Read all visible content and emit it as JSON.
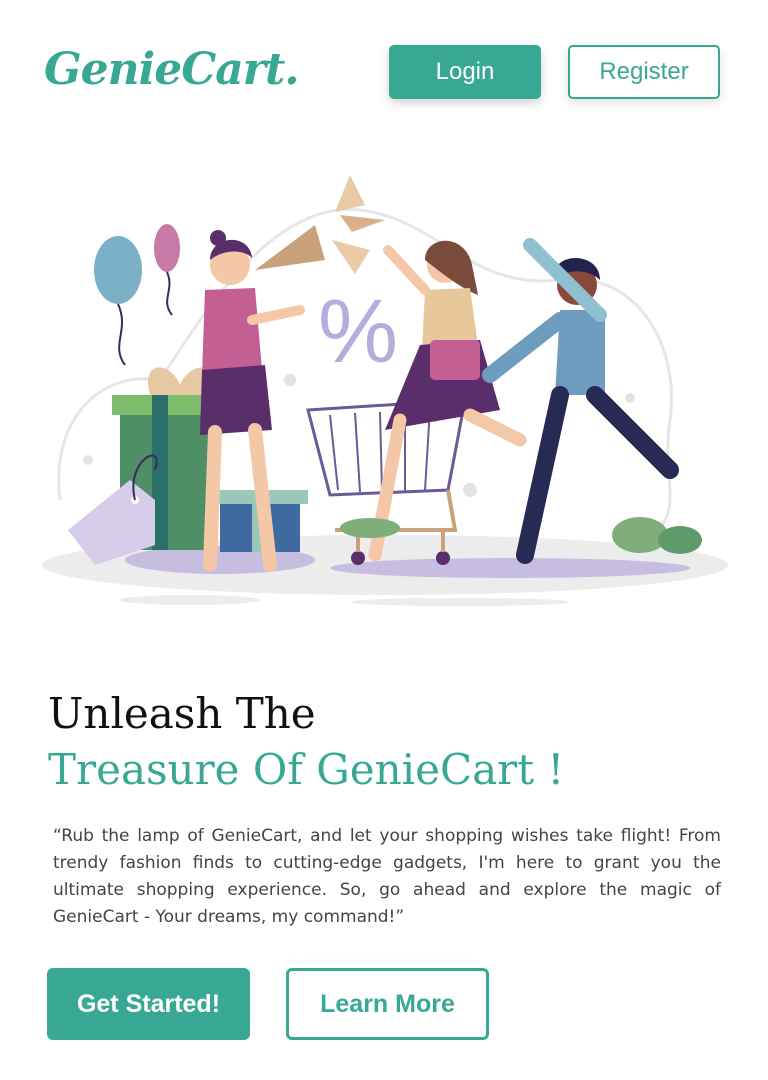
{
  "header": {
    "logo": "GenieCart.",
    "login_label": "Login",
    "register_label": "Register"
  },
  "hero": {
    "illustration": "shopping-celebration-illustration",
    "percent_symbol": "%"
  },
  "headline": {
    "line1": "Unleash The",
    "line2": "Treasure Of GenieCart !"
  },
  "description": "“Rub the lamp of GenieCart, and let your shopping wishes take flight! From trendy fashion finds to cutting-edge gadgets, I'm here to grant you the ultimate shopping experience. So, go ahead and explore the magic of GenieCart - Your dreams, my command!”",
  "cta": {
    "get_started_label": "Get Started!",
    "learn_more_label": "Learn More"
  },
  "colors": {
    "accent": "#38a894",
    "text_dark": "#111111",
    "text_body": "#444444"
  }
}
